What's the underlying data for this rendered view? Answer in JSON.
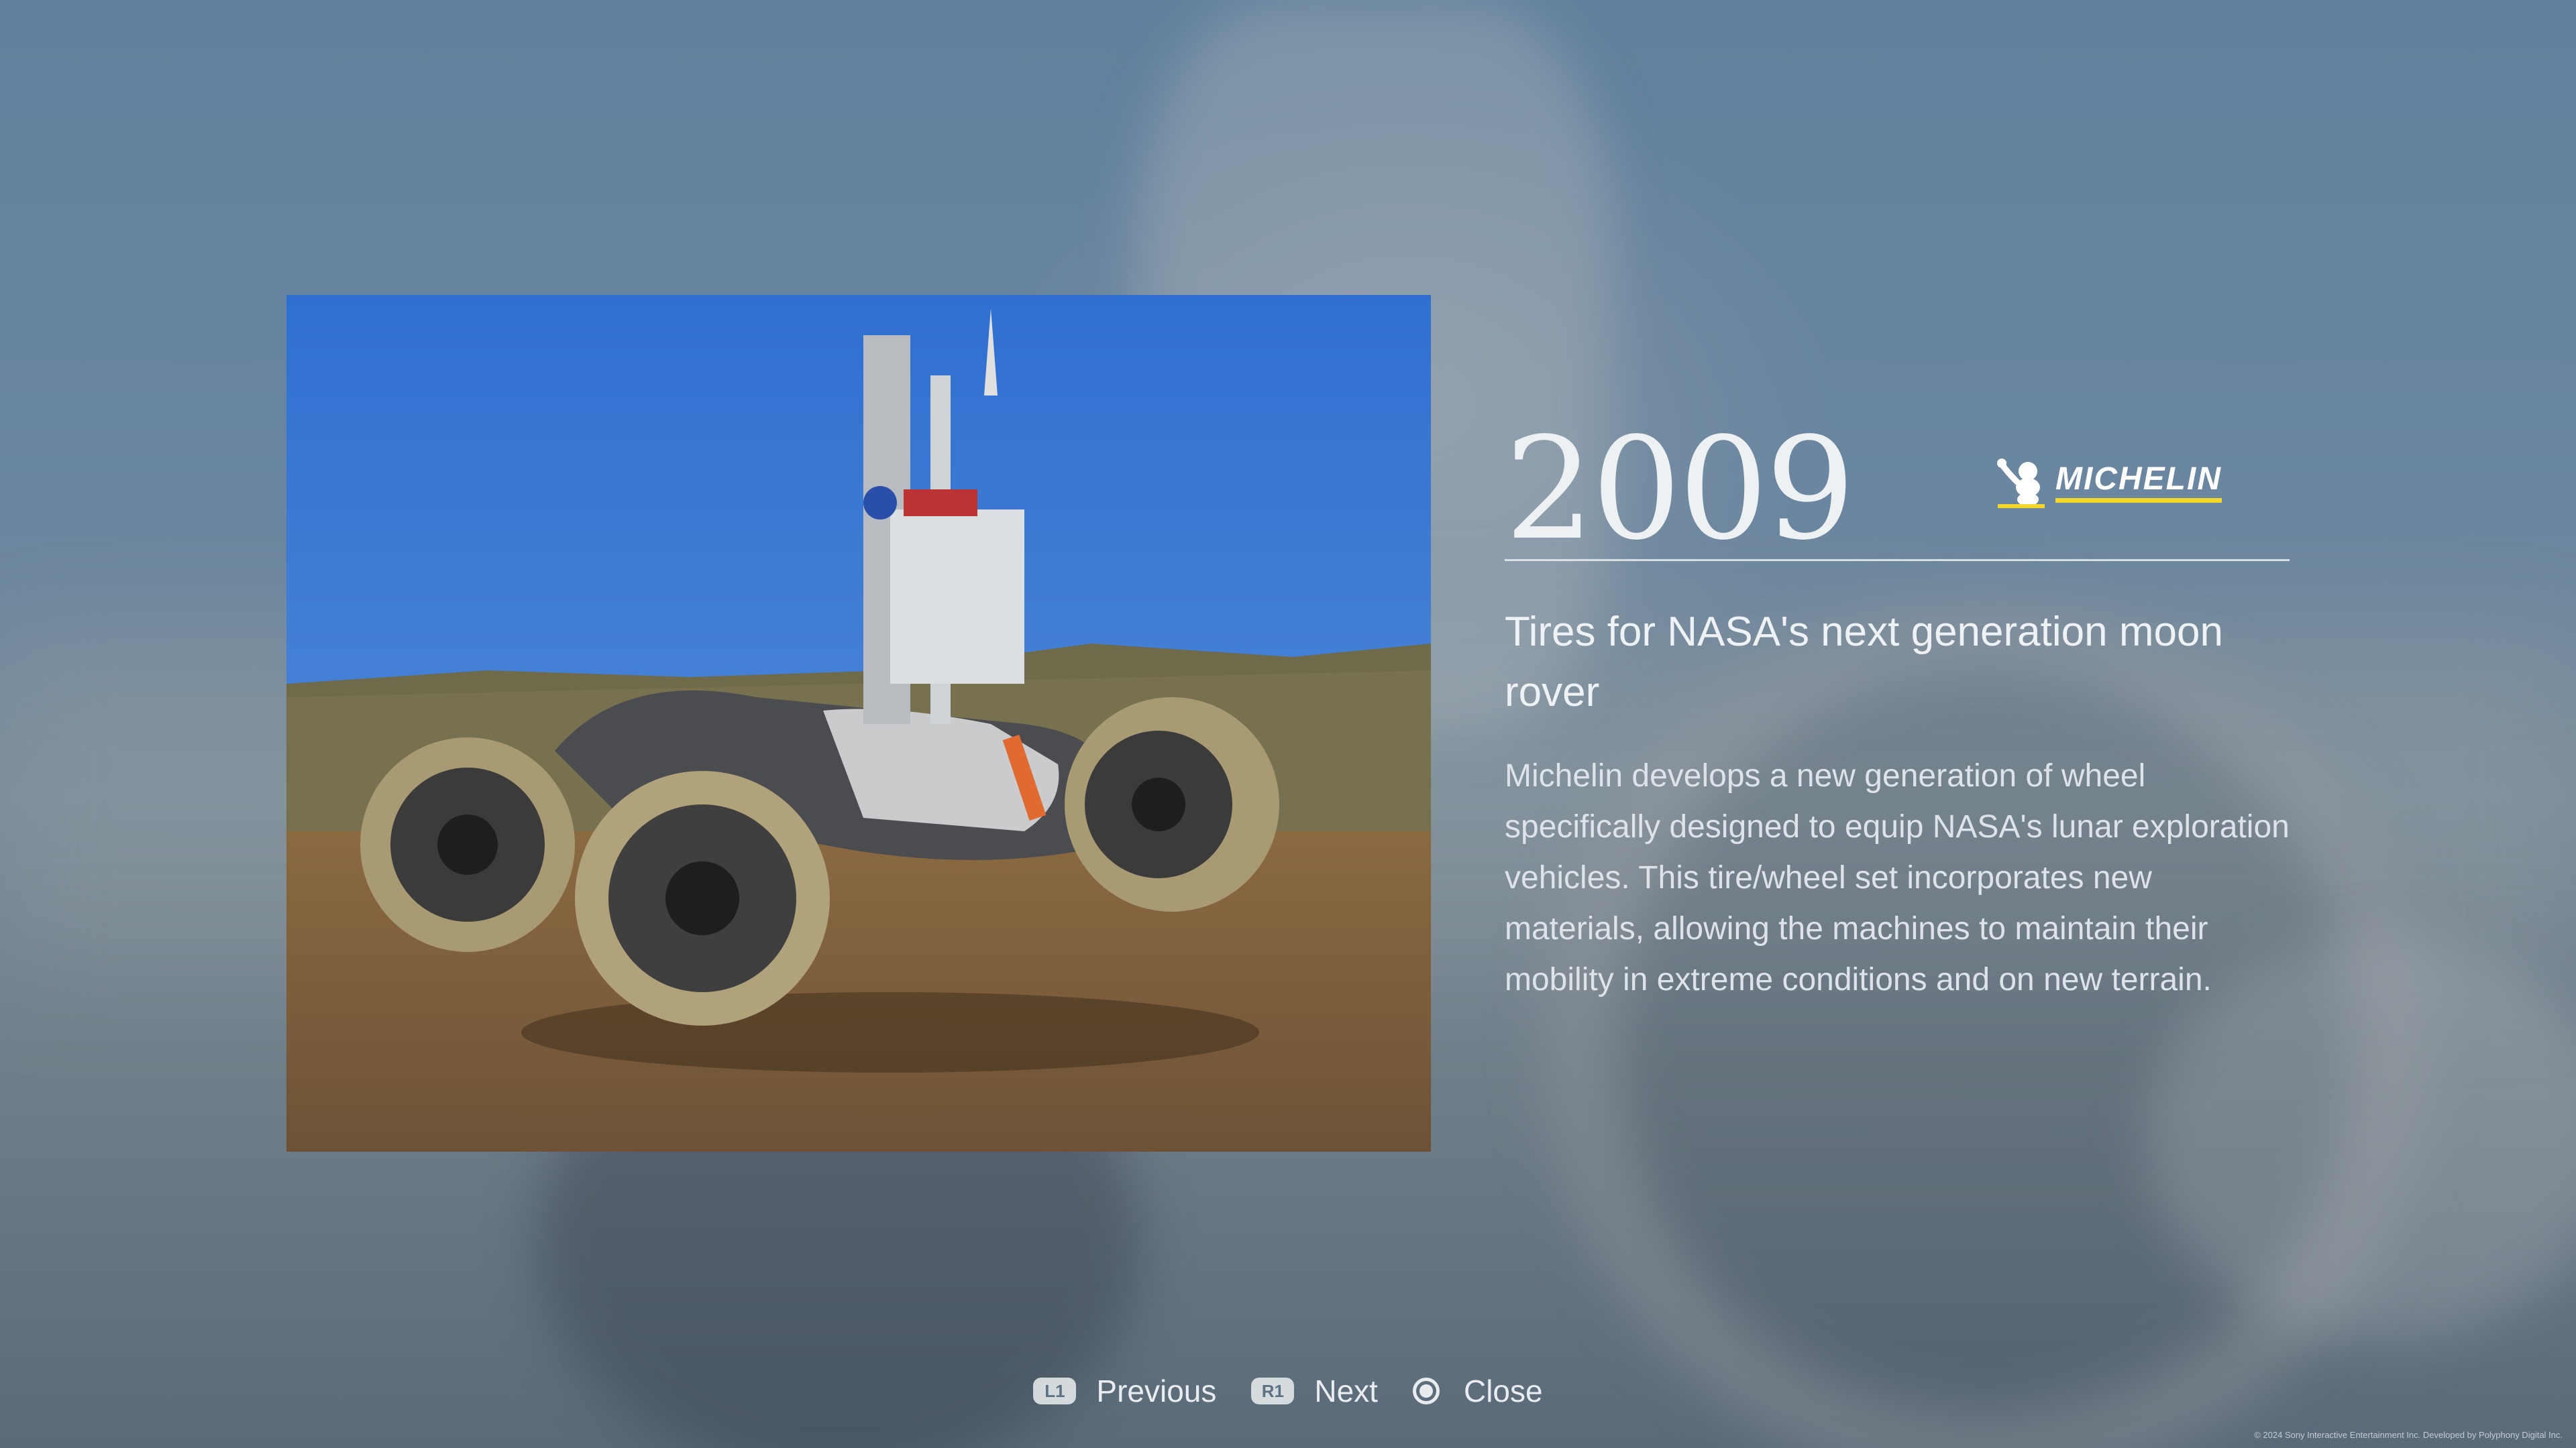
{
  "entry": {
    "year": "2009",
    "brand": "MICHELIN",
    "headline": "Tires for NASA's next generation moon rover",
    "description": "Michelin develops a new generation of wheel specifically designed to equip NASA's lunar exploration vehicles. This tire/wheel set incorporates new materials, allowing the machines to maintain their mobility in extreme conditions and on new terrain."
  },
  "controls": {
    "previous": {
      "key": "L1",
      "label": "Previous"
    },
    "next": {
      "key": "R1",
      "label": "Next"
    },
    "close": {
      "label": "Close"
    }
  },
  "footer": {
    "copyright": "© 2024 Sony Interactive Entertainment Inc. Developed by Polyphony Digital Inc."
  },
  "colors": {
    "background": "#6b8296",
    "text": "#e8ecef",
    "brand_underline": "#f2d629"
  }
}
